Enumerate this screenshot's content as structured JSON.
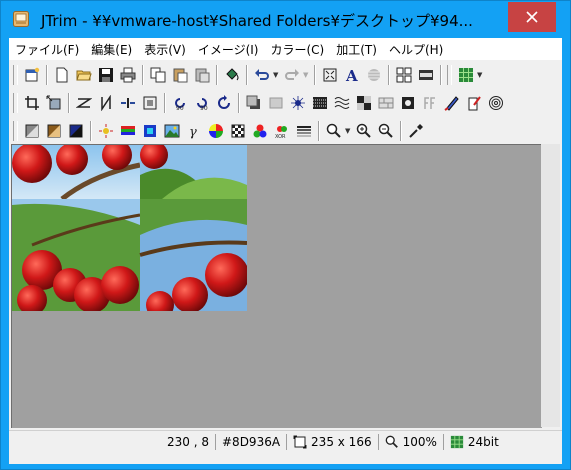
{
  "window": {
    "title": "JTrim - ¥¥vmware-host¥Shared Folders¥デスクトップ¥94...",
    "accent": "#13a1f4",
    "close_color": "#c74343"
  },
  "menu": [
    {
      "label": "ファイル(F)"
    },
    {
      "label": "編集(E)"
    },
    {
      "label": "表示(V)"
    },
    {
      "label": "イメージ(I)"
    },
    {
      "label": "カラー(C)"
    },
    {
      "label": "加工(T)"
    },
    {
      "label": "ヘルプ(H)"
    }
  ],
  "toolbars": {
    "row1": [
      "new-window-icon",
      "new-file-icon",
      "open-folder-icon",
      "save-icon",
      "print-icon",
      "copy-icon",
      "paste-icon",
      "paste-new-icon",
      "fill-bucket-icon",
      "undo-icon",
      "redo-icon",
      "fit-window-icon",
      "text-icon",
      "gradient-circle-icon",
      "grid-view-icon",
      "film-strip-icon",
      "color-grid-icon"
    ],
    "row2": [
      "crop-icon",
      "resize-icon",
      "flip-horizontal-icon",
      "flip-vertical-icon",
      "center-icon",
      "frame-icon",
      "rotate-left-90-icon",
      "rotate-right-90-icon",
      "rotate-icon",
      "shadow-icon",
      "flat-square-icon",
      "sparkle-icon",
      "mosaic-icon",
      "wave-icon",
      "emboss-icon",
      "brick-icon",
      "blur-icon",
      "ff-icon",
      "pen-icon",
      "ink-icon",
      "spiral-icon"
    ],
    "row3": [
      "grayscale-icon",
      "sepia-icon",
      "negative-icon",
      "posterize-icon",
      "rgb-bars-icon",
      "color-balance-icon",
      "picture-icon",
      "gamma-icon",
      "color-wheel-icon",
      "checker-icon",
      "rgb-dots-icon",
      "xor-icon",
      "gradient-bars-icon",
      "zoom-menu-icon",
      "zoom-in-icon",
      "zoom-out-icon",
      "eyedropper-icon"
    ]
  },
  "status": {
    "coords": "230 , 8",
    "color_hex": "#8D936A",
    "size": "235 x 166",
    "zoom": "100%",
    "bits": "24bit"
  }
}
